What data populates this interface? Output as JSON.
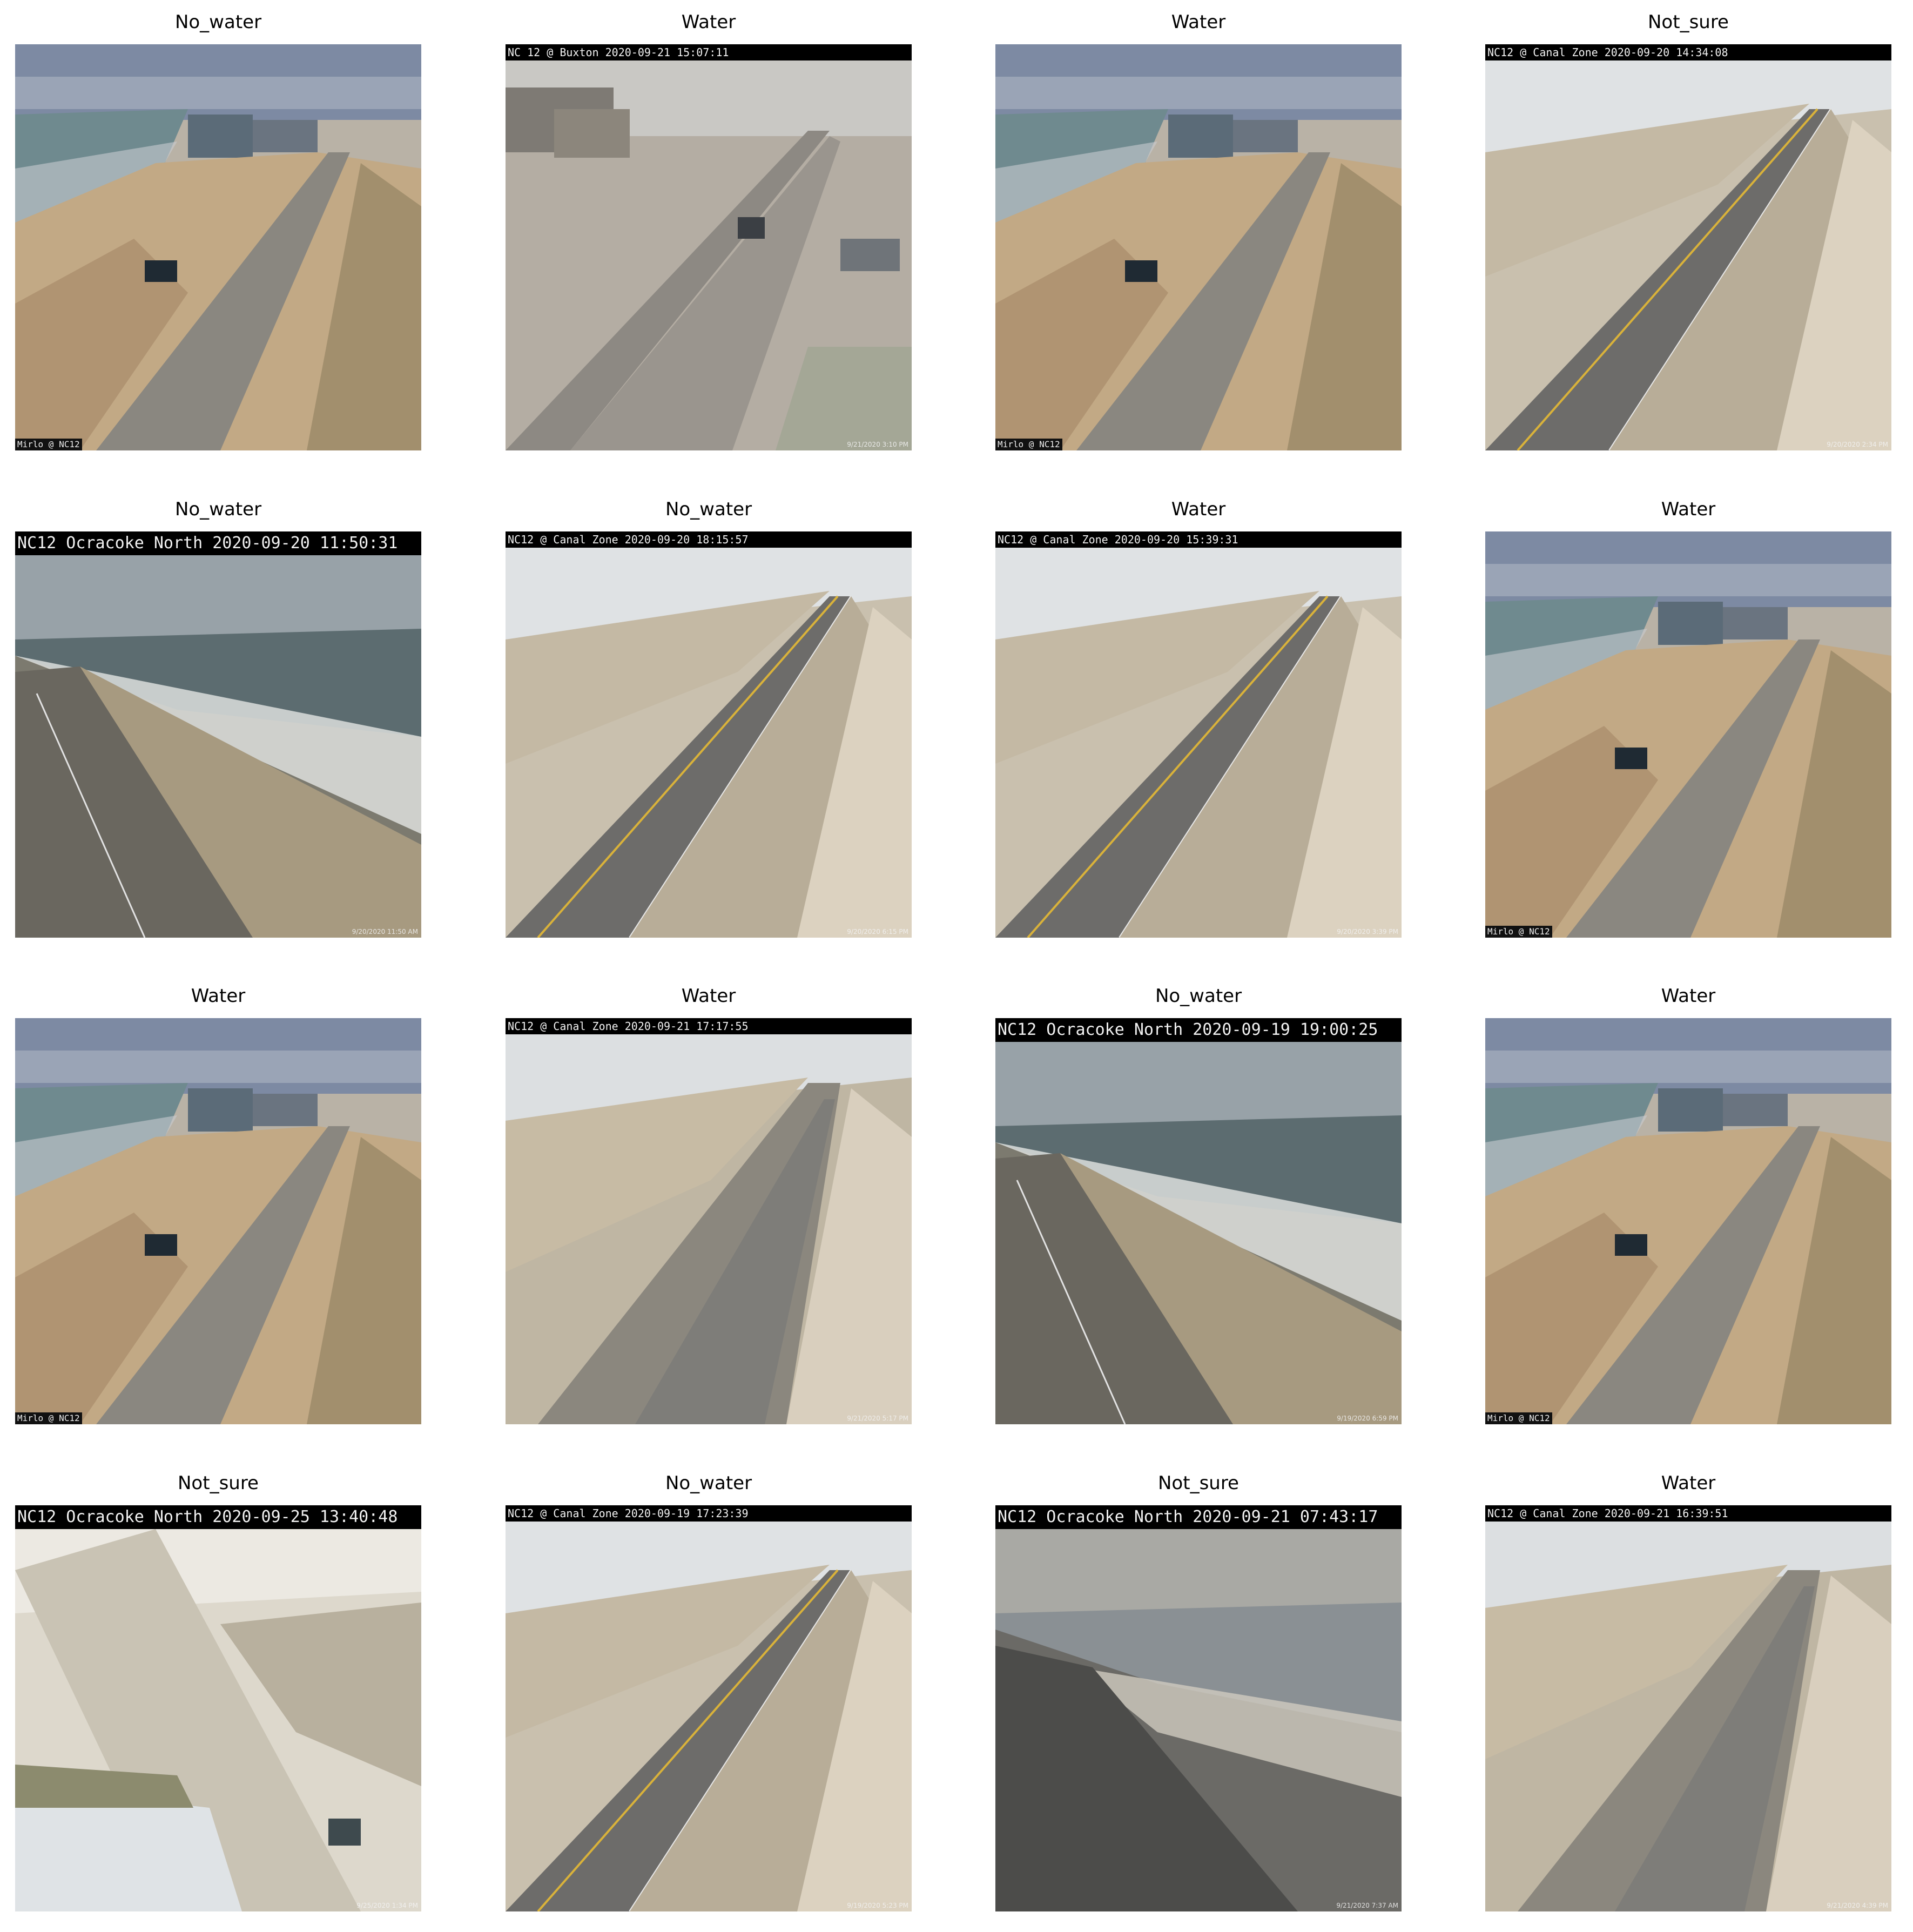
{
  "figure": {
    "panels": [
      {
        "label": "No_water",
        "cam_header": "",
        "cam_corner": "Mirlo @ NC12",
        "cam_time": "",
        "scene": "mirlo"
      },
      {
        "label": "Water",
        "cam_header": "NC 12 @ Buxton 2020-09-21 15:07:11",
        "cam_corner": "",
        "cam_time": "9/21/2020 3:10 PM",
        "scene": "buxton"
      },
      {
        "label": "Water",
        "cam_header": "",
        "cam_corner": "Mirlo @ NC12",
        "cam_time": "",
        "scene": "mirlo"
      },
      {
        "label": "Not_sure",
        "cam_header": "NC12 @ Canal Zone 2020-09-20 14:34:08",
        "cam_corner": "",
        "cam_time": "9/20/2020 2:34 PM",
        "scene": "canal"
      },
      {
        "label": "No_water",
        "cam_header": "NC12 Ocracoke North 2020-09-20 11:50:31",
        "cam_corner": "",
        "cam_time": "9/20/2020 11:50 AM",
        "scene": "ocracoke"
      },
      {
        "label": "No_water",
        "cam_header": "NC12 @ Canal Zone 2020-09-20 18:15:57",
        "cam_corner": "",
        "cam_time": "9/20/2020 6:15 PM",
        "scene": "canal"
      },
      {
        "label": "Water",
        "cam_header": "NC12 @ Canal Zone 2020-09-20 15:39:31",
        "cam_corner": "",
        "cam_time": "9/20/2020 3:39 PM",
        "scene": "canal"
      },
      {
        "label": "Water",
        "cam_header": "",
        "cam_corner": "Mirlo @ NC12",
        "cam_time": "",
        "scene": "mirlo"
      },
      {
        "label": "Water",
        "cam_header": "",
        "cam_corner": "Mirlo @ NC12",
        "cam_time": "",
        "scene": "mirlo"
      },
      {
        "label": "Water",
        "cam_header": "NC12 @ Canal Zone 2020-09-21 17:17:55",
        "cam_corner": "",
        "cam_time": "9/21/2020 5:17 PM",
        "scene": "canal-flood"
      },
      {
        "label": "No_water",
        "cam_header": "NC12 Ocracoke North 2020-09-19 19:00:25",
        "cam_corner": "",
        "cam_time": "9/19/2020 6:59 PM",
        "scene": "ocracoke"
      },
      {
        "label": "Water",
        "cam_header": "",
        "cam_corner": "Mirlo @ NC12",
        "cam_time": "",
        "scene": "mirlo"
      },
      {
        "label": "Not_sure",
        "cam_header": "NC12 Ocracoke North 2020-09-25 13:40:48",
        "cam_corner": "",
        "cam_time": "9/25/2020 1:34 PM",
        "scene": "washed"
      },
      {
        "label": "No_water",
        "cam_header": "NC12 @ Canal Zone 2020-09-19 17:23:39",
        "cam_corner": "",
        "cam_time": "9/19/2020 5:23 PM",
        "scene": "canal"
      },
      {
        "label": "Not_sure",
        "cam_header": "NC12 Ocracoke North 2020-09-21 07:43:17",
        "cam_corner": "",
        "cam_time": "9/21/2020 7:37 AM",
        "scene": "ocracoke-dawn"
      },
      {
        "label": "Water",
        "cam_header": "NC12 @ Canal Zone 2020-09-21 16:39:51",
        "cam_corner": "",
        "cam_time": "9/21/2020 4:39 PM",
        "scene": "canal-flood"
      }
    ]
  }
}
